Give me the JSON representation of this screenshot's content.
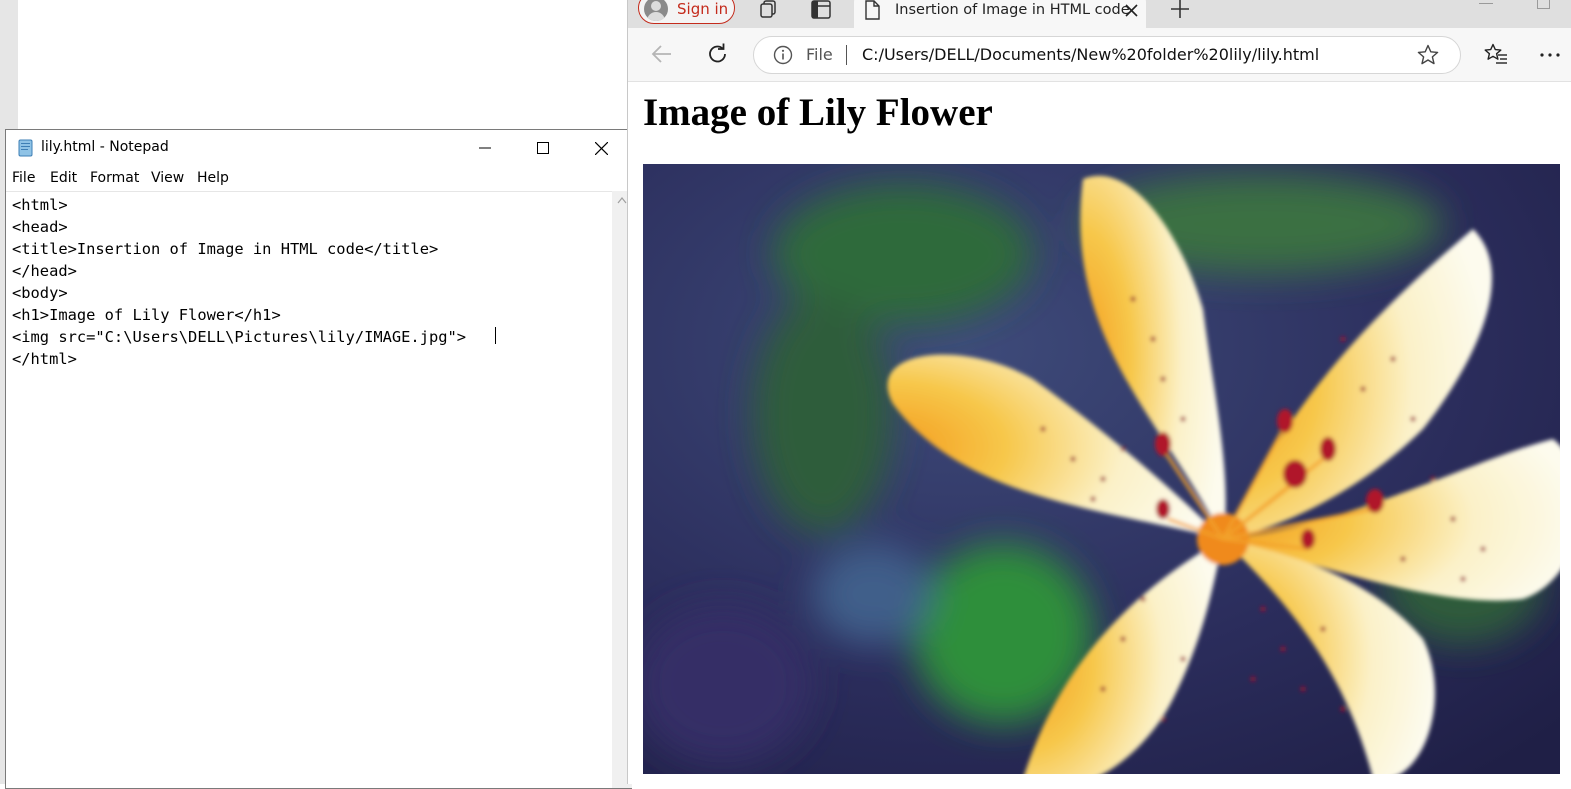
{
  "notepad": {
    "title": "lily.html - Notepad",
    "menu": [
      "File",
      "Edit",
      "Format",
      "View",
      "Help"
    ],
    "content": "<html>\n<head>\n<title>Insertion of Image in HTML code</title>\n</head>\n<body>\n<h1>Image of Lily Flower</h1>\n<img src=\"C:\\Users\\DELL\\Pictures\\lily/IMAGE.jpg\">\n</html>"
  },
  "browser": {
    "sign_in_label": "Sign in",
    "tab_title": "Insertion of Image in HTML code",
    "address": {
      "scheme_label": "File",
      "url": "C:/Users/DELL/Documents/New%20folder%20lily/lily.html"
    },
    "page": {
      "heading": "Image of Lily Flower"
    }
  },
  "icons": {
    "notepad_app": "notepad-icon",
    "minimize": "minimize-icon",
    "maximize": "maximize-icon",
    "close": "close-icon",
    "workspaces": "workspaces-icon",
    "vertical_tabs": "tab-actions-icon",
    "page": "page-icon",
    "new_tab": "plus-icon",
    "back": "back-arrow-icon",
    "refresh": "refresh-icon",
    "info": "info-icon",
    "favorite": "star-icon",
    "favorites": "favorites-icon",
    "more": "more-icon"
  },
  "colors": {
    "sign_in_accent": "#c42b1c",
    "tabstrip": "#dfdfdf",
    "toolbar": "#f7f7f7"
  }
}
